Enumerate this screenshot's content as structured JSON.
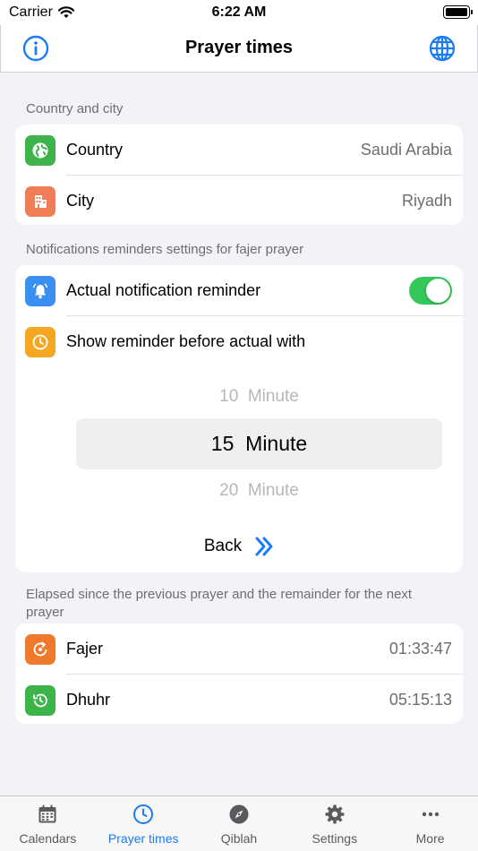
{
  "status_bar": {
    "carrier": "Carrier",
    "time": "6:22 AM"
  },
  "nav": {
    "title": "Prayer times",
    "left_icon": "info-icon",
    "right_icon": "globe-icon"
  },
  "location": {
    "header": "Country and city",
    "country_label": "Country",
    "country_value": "Saudi Arabia",
    "city_label": "City",
    "city_value": "Riyadh"
  },
  "notifications": {
    "header": "Notifications reminders settings for fajer prayer",
    "actual_label": "Actual notification reminder",
    "actual_enabled": true,
    "before_label": "Show reminder before actual with",
    "picker_options": [
      "10  Minute",
      "15  Minute",
      "20  Minute"
    ],
    "picker_selected": "15  Minute",
    "back_label": "Back"
  },
  "elapsed": {
    "header": "Elapsed since the previous prayer and the remainder for the next prayer",
    "fajer_label": "Fajer",
    "fajer_value": "01:33:47",
    "dhuhr_label": "Dhuhr",
    "dhuhr_value": "05:15:13"
  },
  "tabs": [
    {
      "label": "Calendars",
      "icon": "calendar-icon",
      "active": false
    },
    {
      "label": "Prayer times",
      "icon": "clock-icon",
      "active": true
    },
    {
      "label": "Qiblah",
      "icon": "compass-icon",
      "active": false
    },
    {
      "label": "Settings",
      "icon": "gear-icon",
      "active": false
    },
    {
      "label": "More",
      "icon": "more-icon",
      "active": false
    }
  ],
  "colors": {
    "accent": "#1a7cf5",
    "country_icon_bg": "#3cb44a",
    "city_icon_bg": "#ee7d58",
    "bell_icon_bg": "#3a8ff0",
    "clock_icon_bg": "#f5a623",
    "fajer_icon_bg": "#f07a2c",
    "dhuhr_icon_bg": "#3cb44a",
    "toggle_on": "#34c759"
  }
}
